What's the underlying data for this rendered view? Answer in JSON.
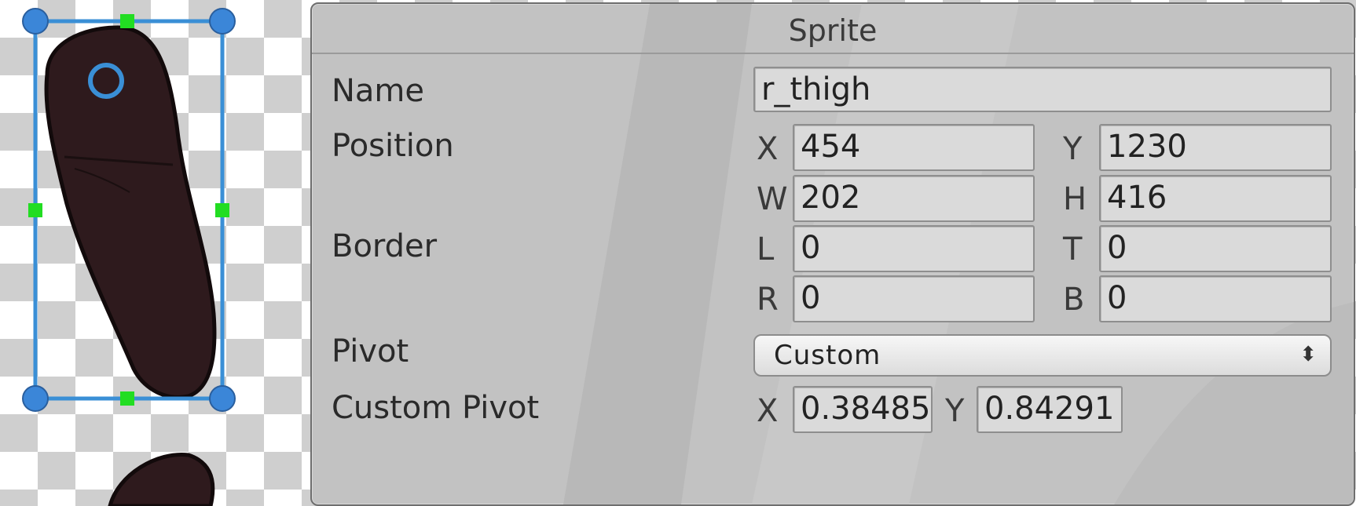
{
  "panel": {
    "title": "Sprite",
    "name_label": "Name",
    "name_value": "r_thigh",
    "position_label": "Position",
    "position": {
      "x_label": "X",
      "x_value": "454",
      "y_label": "Y",
      "y_value": "1230",
      "w_label": "W",
      "w_value": "202",
      "h_label": "H",
      "h_value": "416"
    },
    "border_label": "Border",
    "border": {
      "l_label": "L",
      "l_value": "0",
      "t_label": "T",
      "t_value": "0",
      "r_label": "R",
      "r_value": "0",
      "b_label": "B",
      "b_value": "0"
    },
    "pivot_label": "Pivot",
    "pivot_value": "Custom",
    "pivot_arrow_icon": "up-down-arrows-icon",
    "custom_pivot_label": "Custom Pivot",
    "custom_pivot": {
      "x_label": "X",
      "x_value": "0.38485",
      "y_label": "Y",
      "y_value": "0.84291"
    }
  },
  "canvas": {
    "sprite_color": "#2e1a1d",
    "selection_color": "#3a8fd6",
    "handle_corner_color": "#3b86d8",
    "handle_edge_color": "#22dd22",
    "pivot_icon": "pivot-ring-icon"
  },
  "colors": {
    "panel_bg": "#c2c2c2",
    "checker_dark": "#cfcfcf",
    "checker_light": "#ffffff"
  }
}
